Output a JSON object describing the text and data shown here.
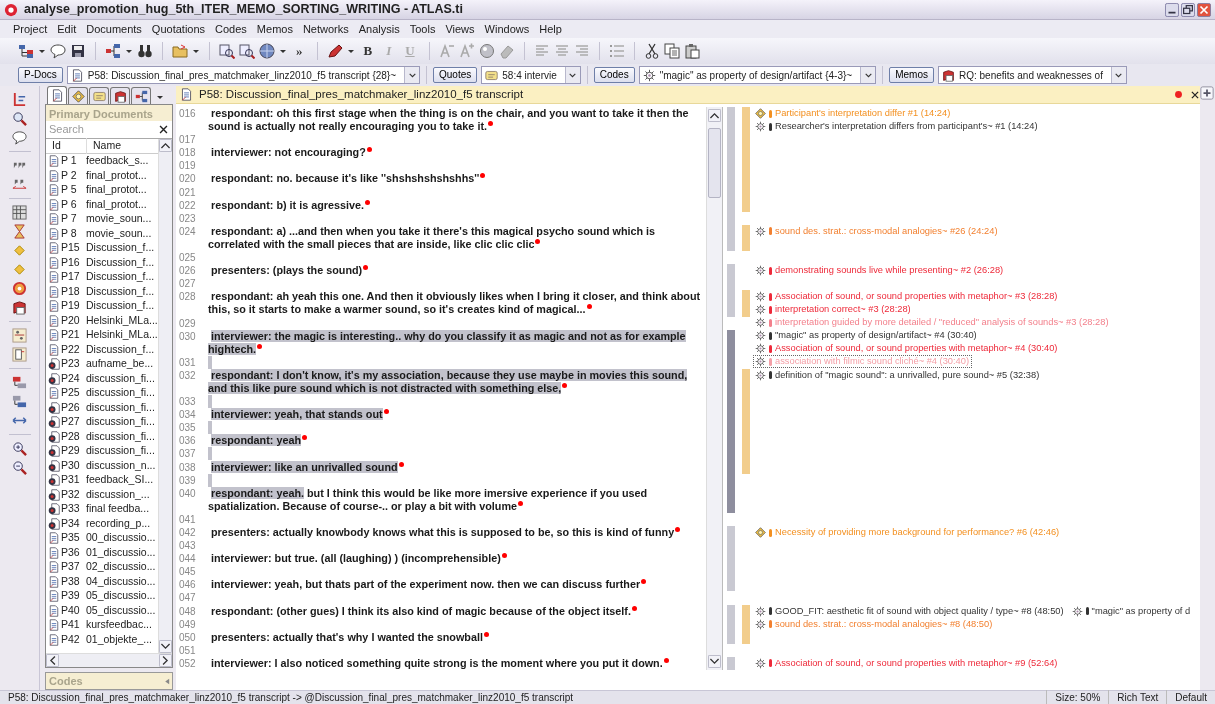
{
  "window": {
    "title": "analyse_promotion_hug_5th_ITER_MEMO_SORTING_WRITING - ATLAS.ti"
  },
  "menu": [
    "Project",
    "Edit",
    "Documents",
    "Quotations",
    "Codes",
    "Memos",
    "Networks",
    "Analysis",
    "Tools",
    "Views",
    "Windows",
    "Help"
  ],
  "toolbar": {
    "overflow": "»",
    "format": [
      "B",
      "I",
      "U"
    ]
  },
  "selectors": [
    {
      "button": "P-Docs",
      "value": "P58: Discussion_final_pres_matchmaker_linz2010_f5 transcript {28}~",
      "kind": "doc"
    },
    {
      "button": "Quotes",
      "value": "58:4 intervie",
      "kind": "quote"
    },
    {
      "button": "Codes",
      "value": "\"magic\" as property of design/artifact {4-3}~",
      "kind": "code"
    },
    {
      "button": "Memos",
      "value": "RQ: benefits and weaknesses of",
      "kind": "memo"
    }
  ],
  "doc_panel": {
    "tabs": [
      {
        "kind": "doc",
        "selected": true
      },
      {
        "kind": "memo",
        "selected": false
      },
      {
        "kind": "quote",
        "selected": false
      },
      {
        "kind": "book",
        "selected": false
      },
      {
        "kind": "network",
        "selected": false
      }
    ],
    "title": "Primary Documents",
    "search": {
      "placeholder": "Search"
    },
    "columns": [
      "Id",
      "Name"
    ],
    "rows": [
      {
        "id": "P 1",
        "name": "feedback_s...",
        "kind": "text"
      },
      {
        "id": "P 2",
        "name": "final_protot...",
        "kind": "text"
      },
      {
        "id": "P 5",
        "name": "final_protot...",
        "kind": "text"
      },
      {
        "id": "P 6",
        "name": "final_protot...",
        "kind": "text"
      },
      {
        "id": "P 7",
        "name": "movie_soun...",
        "kind": "text"
      },
      {
        "id": "P 8",
        "name": "movie_soun...",
        "kind": "text"
      },
      {
        "id": "P15",
        "name": "Discussion_f...",
        "kind": "text"
      },
      {
        "id": "P16",
        "name": "Discussion_f...",
        "kind": "text"
      },
      {
        "id": "P17",
        "name": "Discussion_f...",
        "kind": "text"
      },
      {
        "id": "P18",
        "name": "Discussion_f...",
        "kind": "text"
      },
      {
        "id": "P19",
        "name": "Discussion_f...",
        "kind": "text"
      },
      {
        "id": "P20",
        "name": "Helsinki_MLa...",
        "kind": "text"
      },
      {
        "id": "P21",
        "name": "Helsinki_MLa...",
        "kind": "text"
      },
      {
        "id": "P22",
        "name": "Discussion_f...",
        "kind": "text"
      },
      {
        "id": "P23",
        "name": "aufname_be...",
        "kind": "audio"
      },
      {
        "id": "P24",
        "name": "discussion_fi...",
        "kind": "audio"
      },
      {
        "id": "P25",
        "name": "discussion_fi...",
        "kind": "text"
      },
      {
        "id": "P26",
        "name": "discussion_fi...",
        "kind": "audio"
      },
      {
        "id": "P27",
        "name": "discussion_fi...",
        "kind": "audio"
      },
      {
        "id": "P28",
        "name": "discussion_fi...",
        "kind": "audio"
      },
      {
        "id": "P29",
        "name": "discussion_fi...",
        "kind": "audio"
      },
      {
        "id": "P30",
        "name": "discussion_n...",
        "kind": "audio"
      },
      {
        "id": "P31",
        "name": "feedback_SI...",
        "kind": "audio"
      },
      {
        "id": "P32",
        "name": "discussion_...",
        "kind": "audio"
      },
      {
        "id": "P33",
        "name": "final feedba...",
        "kind": "audio"
      },
      {
        "id": "P34",
        "name": "recording_p...",
        "kind": "audio"
      },
      {
        "id": "P35",
        "name": "00_discussio...",
        "kind": "text"
      },
      {
        "id": "P36",
        "name": "01_discussio...",
        "kind": "text"
      },
      {
        "id": "P37",
        "name": "02_discussio...",
        "kind": "text"
      },
      {
        "id": "P38",
        "name": "04_discussio...",
        "kind": "text"
      },
      {
        "id": "P39",
        "name": "05_discussio...",
        "kind": "text"
      },
      {
        "id": "P40",
        "name": "05_discussio...",
        "kind": "text"
      },
      {
        "id": "P41",
        "name": "kursfeedbac...",
        "kind": "text"
      },
      {
        "id": "P42",
        "name": "01_objekte_...",
        "kind": "text"
      }
    ],
    "collapsed_section": "Codes"
  },
  "document": {
    "title": "P58:  Discussion_final_pres_matchmaker_linz2010_f5  transcript",
    "rows": [
      {
        "num": "016",
        "text": "respondant: oh this first stage when the thing is on the chair, and you want to take it then the sound is actually not really encouraging you to take it.",
        "selected": false,
        "bars": [
          {
            "kind": "outer",
            "color": "#c9c9d2"
          },
          {
            "kind": "inner",
            "color": "#f2cd8c"
          }
        ],
        "margin": [
          [
            {
              "kind": "memo",
              "text": "Participant's interpretation differ  #1  (14:24)",
              "color": "#f39020",
              "selected": false
            }
          ],
          [
            {
              "kind": "code",
              "text": "Researcher's interpretation differs from participant's~  #1  (14:24)",
              "color": "#333333",
              "selected": false
            }
          ]
        ]
      },
      {
        "num": "017",
        "selected": false,
        "bars": [
          {
            "kind": "outer",
            "color": "#c9c9d2"
          },
          {
            "kind": "inner",
            "color": "#f2cd8c"
          }
        ]
      },
      {
        "num": "018",
        "text": "interviewer: not encouraging?",
        "selected": false,
        "bars": [
          {
            "kind": "outer",
            "color": "#c9c9d2"
          },
          {
            "kind": "inner",
            "color": "#f2cd8c"
          }
        ]
      },
      {
        "num": "019",
        "selected": false,
        "bars": [
          {
            "kind": "outer",
            "color": "#c9c9d2"
          },
          {
            "kind": "inner",
            "color": "#f2cd8c"
          }
        ]
      },
      {
        "num": "020",
        "text": "respondant: no. because it's like ''shshshshshshhs''",
        "selected": false,
        "bars": [
          {
            "kind": "outer",
            "color": "#c9c9d2"
          },
          {
            "kind": "inner",
            "color": "#f2cd8c"
          }
        ]
      },
      {
        "num": "021",
        "selected": false,
        "bars": [
          {
            "kind": "outer",
            "color": "#c9c9d2"
          },
          {
            "kind": "inner",
            "color": "#f2cd8c"
          }
        ]
      },
      {
        "num": "022",
        "text": "respondant: b) it is agressive.",
        "selected": false,
        "bars": [
          {
            "kind": "outer",
            "color": "#c9c9d2"
          },
          {
            "kind": "inner",
            "color": "#f2cd8c"
          }
        ]
      },
      {
        "num": "023",
        "selected": false,
        "bars": [
          {
            "kind": "outer",
            "color": "#c9c9d2"
          }
        ]
      },
      {
        "num": "024",
        "text": "respondant: a) ...and then when you take it there's this magical psycho sound which is correlated with the small pieces that are inside, like clic clic clic",
        "selected": false,
        "bars": [
          {
            "kind": "outer",
            "color": "#c9c9d2"
          },
          {
            "kind": "inner",
            "color": "#f2cd8c"
          }
        ],
        "margin": [
          [
            {
              "kind": "code",
              "text": "sound des. strat.: cross-modal analogies~  #26  (24:24)",
              "color": "#f28030",
              "selected": false
            }
          ]
        ]
      },
      {
        "num": "025",
        "selected": false
      },
      {
        "num": "026",
        "text": "presenters: (plays the sound)",
        "selected": false,
        "bars": [
          {
            "kind": "outer",
            "color": "#c9c9d2"
          }
        ],
        "margin": [
          [
            {
              "kind": "code",
              "text": "demonstrating sounds live while presenting~  #2  (26:28)",
              "color": "#ee2a3a",
              "selected": false
            }
          ]
        ]
      },
      {
        "num": "027",
        "selected": false,
        "bars": [
          {
            "kind": "outer",
            "color": "#c9c9d2"
          }
        ]
      },
      {
        "num": "028",
        "text": "respondant: ah yeah this one. And then it obviously likes when I bring it closer, and think about this, so it starts to make a warmer sound, so it's creates kind of magical...",
        "selected": false,
        "bars": [
          {
            "kind": "outer",
            "color": "#c9c9d2"
          },
          {
            "kind": "inner",
            "color": "#f2cd8c"
          }
        ],
        "margin": [
          [
            {
              "kind": "code",
              "text": "Association of sound, or sound properties with metaphor~  #3  (28:28)",
              "color": "#ee2a3a",
              "selected": false
            }
          ],
          [
            {
              "kind": "code",
              "text": "interpretation correct~  #3  (28:28)",
              "color": "#ee2a3a",
              "selected": false
            }
          ],
          [
            {
              "kind": "code",
              "text": "interpretation guided by more detailed / \"reduced\" analysis of sounds~  #3  (28:28)",
              "color": "#f3808c",
              "selected": false
            }
          ],
          [
            {
              "kind": "code",
              "text": "\"magic\" as property of design/artifact~  #4  (30:40)",
              "color": "#333333",
              "selected": false
            }
          ],
          [
            {
              "kind": "code",
              "text": "Association of sound, or sound properties with metaphor~  #4  (30:40)",
              "color": "#ee2a3a",
              "selected": false
            }
          ],
          [
            {
              "kind": "code",
              "text": "association with filmic sound cliché~  #4  (30:40)",
              "color": "#f4a0a8",
              "selected": true
            }
          ]
        ]
      },
      {
        "num": "029",
        "selected": false
      },
      {
        "num": "030",
        "text": "interviewer: the magic is interesting.. why do you classify it as magic and not as for example hightech.",
        "selected": true,
        "bars": [
          {
            "kind": "outer",
            "color": "#8e8e9e"
          }
        ]
      },
      {
        "num": "031",
        "selected": true,
        "bars": [
          {
            "kind": "outer",
            "color": "#8e8e9e"
          }
        ]
      },
      {
        "num": "032",
        "text": "respondant: I don't know, it's my association, because they use maybe in movies this sound, and this like pure sound which is not distracted with something else,",
        "selected": true,
        "bars": [
          {
            "kind": "outer",
            "color": "#8e8e9e"
          },
          {
            "kind": "inner",
            "color": "#f2cd8c"
          }
        ],
        "margin": [
          [
            {
              "kind": "code",
              "text": "definition of \"magic sound\": a unrivalled, pure sound~  #5  (32:38)",
              "color": "#333333",
              "selected": false
            }
          ]
        ]
      },
      {
        "num": "033",
        "selected": true,
        "bars": [
          {
            "kind": "outer",
            "color": "#8e8e9e"
          },
          {
            "kind": "inner",
            "color": "#f2cd8c"
          }
        ]
      },
      {
        "num": "034",
        "text": "interviewer: yeah, that stands out",
        "selected": true,
        "bars": [
          {
            "kind": "outer",
            "color": "#8e8e9e"
          },
          {
            "kind": "inner",
            "color": "#f2cd8c"
          }
        ]
      },
      {
        "num": "035",
        "selected": true,
        "bars": [
          {
            "kind": "outer",
            "color": "#8e8e9e"
          },
          {
            "kind": "inner",
            "color": "#f2cd8c"
          }
        ]
      },
      {
        "num": "036",
        "text": "respondant: yeah",
        "selected": true,
        "bars": [
          {
            "kind": "outer",
            "color": "#8e8e9e"
          },
          {
            "kind": "inner",
            "color": "#f2cd8c"
          }
        ]
      },
      {
        "num": "037",
        "selected": true,
        "bars": [
          {
            "kind": "outer",
            "color": "#8e8e9e"
          },
          {
            "kind": "inner",
            "color": "#f2cd8c"
          }
        ]
      },
      {
        "num": "038",
        "text": "interviewer: like an unrivalled sound",
        "selected": true,
        "bars": [
          {
            "kind": "outer",
            "color": "#8e8e9e"
          },
          {
            "kind": "inner",
            "color": "#f2cd8c"
          }
        ]
      },
      {
        "num": "039",
        "selected": true,
        "bars": [
          {
            "kind": "outer",
            "color": "#8e8e9e"
          }
        ]
      },
      {
        "num": "040",
        "text": "respondant: yeah.",
        "selected": true,
        "continuation": " but I think this would  be like more imersive experience if you used spatialization. Because of course-.. or play a bit with volume",
        "bars": [
          {
            "kind": "outer",
            "color": "#8e8e9e"
          }
        ]
      },
      {
        "num": "041",
        "selected": false
      },
      {
        "num": "042",
        "text": "presenters: actually knowbody knows what this is supposed to be, so this is kind of funny",
        "selected": false,
        "bars": [
          {
            "kind": "outer",
            "color": "#c9c9d2"
          }
        ],
        "margin": [
          [
            {
              "kind": "memo",
              "text": "Necessity of providing more background for performance?  #6  (42:46)",
              "color": "#f39020",
              "selected": false
            }
          ]
        ]
      },
      {
        "num": "043",
        "selected": false,
        "bars": [
          {
            "kind": "outer",
            "color": "#c9c9d2"
          }
        ]
      },
      {
        "num": "044",
        "text": "interviewer: but true. (all (laughing) ) (incomprehensible)",
        "selected": false,
        "bars": [
          {
            "kind": "outer",
            "color": "#c9c9d2"
          }
        ]
      },
      {
        "num": "045",
        "selected": false,
        "bars": [
          {
            "kind": "outer",
            "color": "#c9c9d2"
          }
        ]
      },
      {
        "num": "046",
        "text": "interviewer: yeah, but thats part of the experiment now. then we can discuss further",
        "selected": false,
        "bars": [
          {
            "kind": "outer",
            "color": "#c9c9d2"
          }
        ]
      },
      {
        "num": "047",
        "selected": false
      },
      {
        "num": "048",
        "text": "respondant: (other gues) I think its also kind of magic because of the object itself.",
        "selected": false,
        "bars": [
          {
            "kind": "outer",
            "color": "#c9c9d2"
          },
          {
            "kind": "inner",
            "color": "#f2cd8c"
          }
        ],
        "margin": [
          [
            {
              "kind": "code",
              "text": "GOOD_FIT: aesthetic fit of sound with object quality / type~  #8  (48:50)",
              "color": "#333333",
              "selected": false
            },
            {
              "kind": "code",
              "text": "\"magic\" as property of d",
              "color": "#333333",
              "selected": false
            }
          ],
          [
            {
              "kind": "code",
              "text": "sound des. strat.: cross-modal analogies~  #8  (48:50)",
              "color": "#f28030",
              "selected": false
            }
          ]
        ]
      },
      {
        "num": "049",
        "selected": false,
        "bars": [
          {
            "kind": "outer",
            "color": "#c9c9d2"
          },
          {
            "kind": "inner",
            "color": "#f2cd8c"
          }
        ]
      },
      {
        "num": "050",
        "text": "presenters: actually that's why I wanted the snowball",
        "selected": false,
        "bars": [
          {
            "kind": "outer",
            "color": "#c9c9d2"
          },
          {
            "kind": "inner",
            "color": "#f2cd8c"
          }
        ]
      },
      {
        "num": "051",
        "selected": false
      },
      {
        "num": "052",
        "text": "interviewer: I also noticed something quite strong is the moment where you put it down.",
        "selected": false,
        "bars": [
          {
            "kind": "outer",
            "color": "#c9c9d2"
          }
        ],
        "margin": [
          [
            {
              "kind": "code",
              "text": "Association of sound, or sound properties with metaphor~  #9  (52:64)",
              "color": "#ee2a3a",
              "selected": false
            }
          ]
        ]
      }
    ]
  },
  "status_bar": {
    "path": "P58: Discussion_final_pres_matchmaker_linz2010_f5 transcript -> @Discussion_final_pres_matchmaker_linz2010_f5 transcript",
    "items": [
      "Size: 50%",
      "Rich Text",
      "Default"
    ]
  }
}
